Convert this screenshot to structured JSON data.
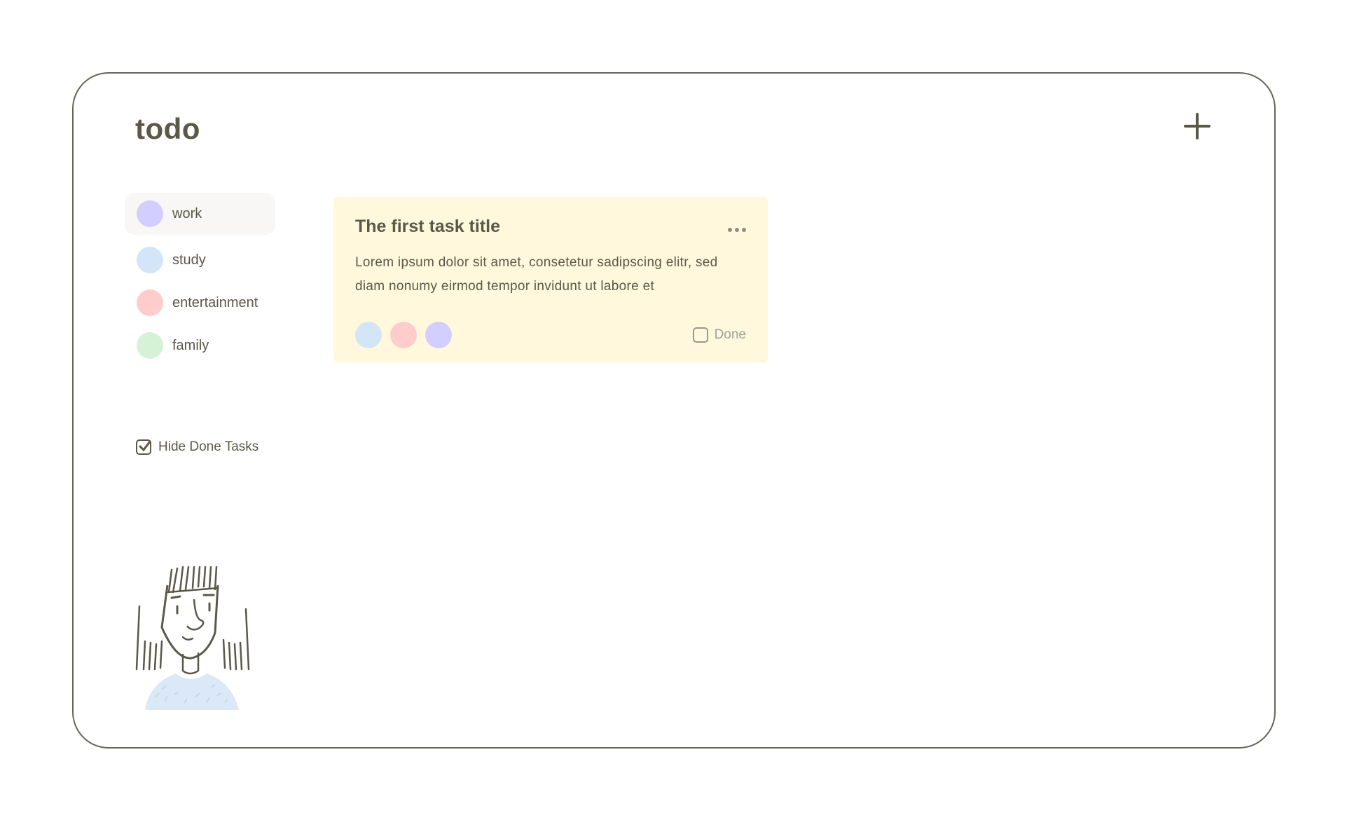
{
  "app": {
    "title": "todo",
    "add_button_icon": "plus-icon"
  },
  "sidebar": {
    "categories": [
      {
        "label": "work",
        "color": "#d2ceff",
        "active": true
      },
      {
        "label": "study",
        "color": "#d2e6f7"
      },
      {
        "label": "entertainment",
        "color": "#ffcccc"
      },
      {
        "label": "family",
        "color": "#d5f2d6"
      }
    ],
    "hide_done": {
      "label": "Hide Done Tasks",
      "checked": true
    }
  },
  "tasks": [
    {
      "title": "The first task title",
      "description": "Lorem ipsum dolor sit amet, consetetur sadipscing elitr, sed diam nonumy eirmod tempor invidunt ut labore et",
      "tag_colors": [
        "#d2e6f7",
        "#ffcccc",
        "#d2ceff"
      ],
      "done_label": "Done",
      "done": false,
      "card_color": "#fff8dc",
      "menu_icon": "more-horizontal-icon"
    }
  ],
  "avatar": {
    "icon": "person-illustration-icon"
  }
}
